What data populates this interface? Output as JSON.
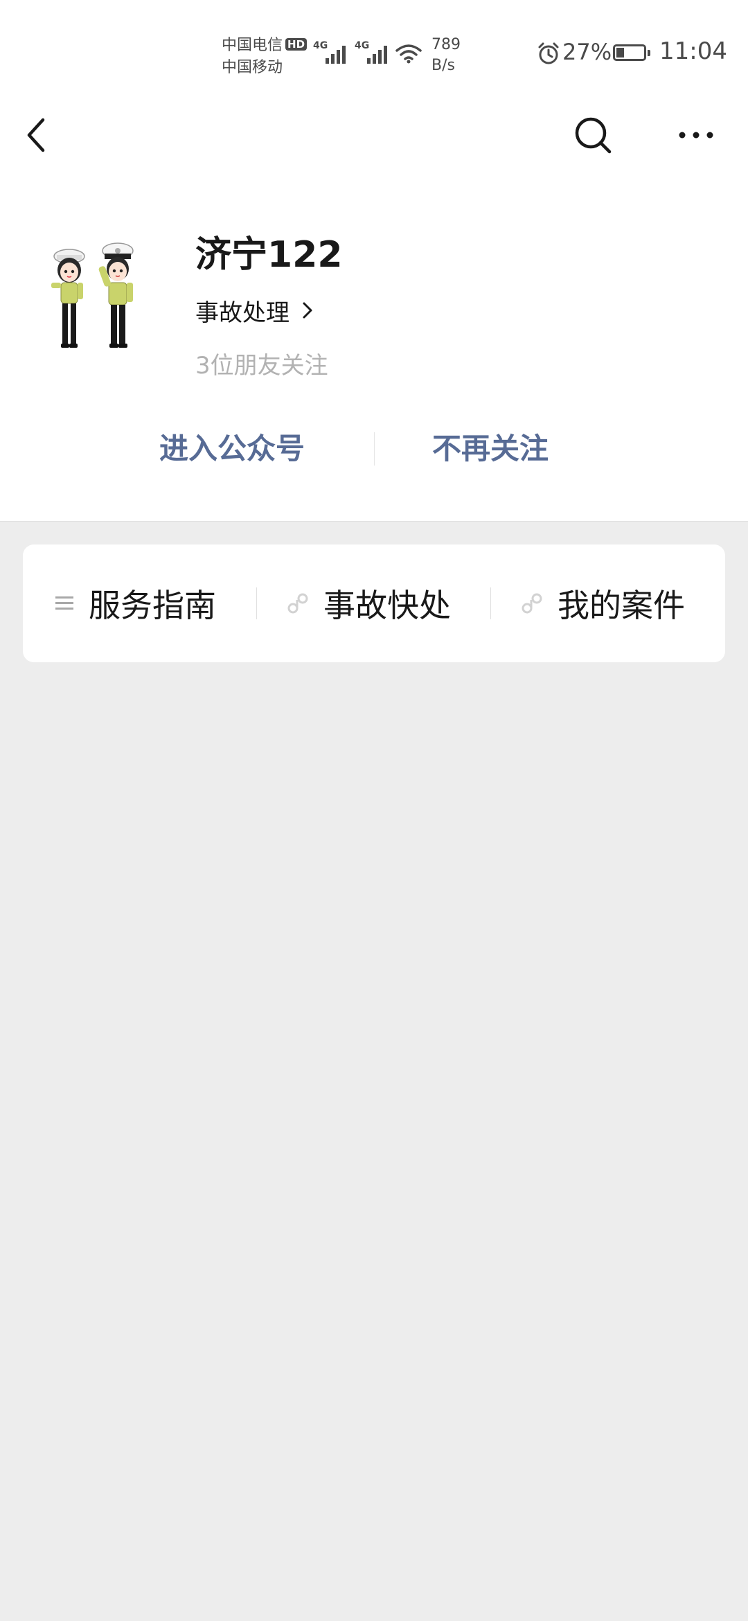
{
  "status_bar": {
    "carrier_primary": "中国电信",
    "hd_badge": "HD",
    "carrier_secondary": "中国移动",
    "signal_1": "4G",
    "signal_2": "4G",
    "speed_value": "789",
    "speed_unit": "B/s",
    "battery_percent": "27%",
    "time": "11:04"
  },
  "nav": {
    "back_icon": "chevron-left-icon",
    "search_icon": "search-icon",
    "more_icon": "more-horizontal-icon"
  },
  "profile": {
    "avatar_icon": "traffic-police-cartoon-avatar",
    "name": "济宁122",
    "intro": "事故处理",
    "friends_following": "3位朋友关注"
  },
  "actions": {
    "enter": "进入公众号",
    "unfollow": "不再关注"
  },
  "menu": {
    "items": [
      {
        "label": "服务指南",
        "icon": "menu-list-icon"
      },
      {
        "label": "事故快处",
        "icon": "mini-program-icon"
      },
      {
        "label": "我的案件",
        "icon": "mini-program-icon"
      }
    ]
  },
  "colors": {
    "link": "#576b95",
    "background": "#ededed",
    "card": "#ffffff",
    "muted": "#b2b2b2"
  }
}
